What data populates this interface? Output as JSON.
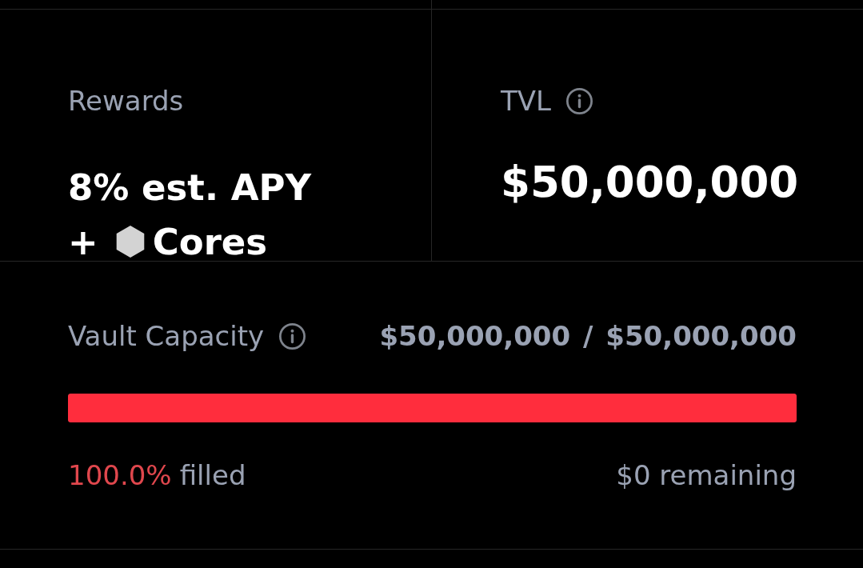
{
  "stats": [
    {
      "kind": "rewards",
      "label": "Rewards",
      "info": false,
      "apy": "8% est. APY",
      "plus": "+",
      "token": "Cores"
    },
    {
      "kind": "amount",
      "label": "TVL",
      "info": true,
      "value": "$50,000,000"
    }
  ],
  "capacity": {
    "label": "Vault Capacity",
    "info": true,
    "amount": "$50,000,000 / $50,000,000",
    "level": 1,
    "percent": "100.0%",
    "percent_suffix": "filled",
    "remaining": "$0 remaining"
  }
}
